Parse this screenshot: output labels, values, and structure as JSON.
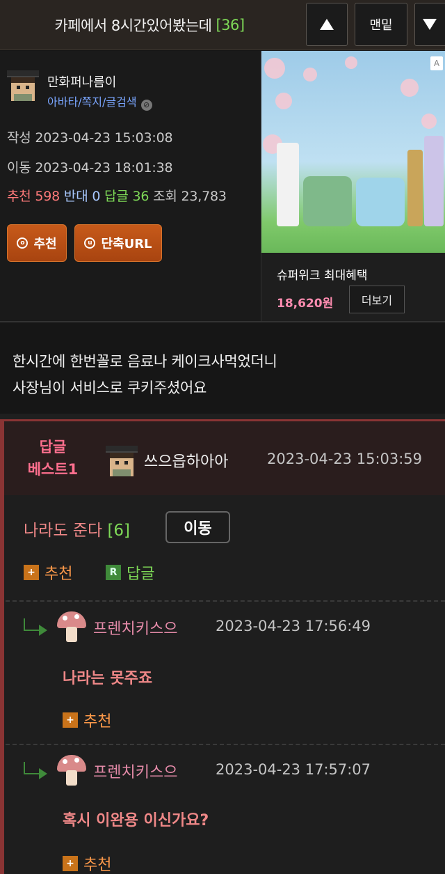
{
  "header": {
    "title": "카페에서 8시간있어봤는데",
    "reply_count": "[36]",
    "bottom_label": "맨밑"
  },
  "post": {
    "author": "만화퍼나름이",
    "author_links": "아바타/쪽지/글검색",
    "written_label": "작성",
    "written": "2023-04-23 15:03:08",
    "moved_label": "이동",
    "moved": "2023-04-23 18:01:38",
    "stats": {
      "rec_label": "추천",
      "rec": "598",
      "anti_label": "반대",
      "anti": "0",
      "reply_label": "답글",
      "reply": "36",
      "views_label": "조회",
      "views": "23,783"
    },
    "buttons": {
      "recommend": "추천",
      "short_url": "단축URL"
    },
    "content": [
      "한시간에 한번꼴로 음료나 케이크사먹었더니",
      "사장님이 서비스로 쿠키주셨어요"
    ]
  },
  "ad": {
    "badge": "A",
    "name": "슈퍼위크 최대혜택",
    "price": "18,620원",
    "more": "더보기"
  },
  "best_reply": {
    "label_line1": "답글",
    "label_line2": "베스트1",
    "author": "쓰으읍하아아",
    "time": "2023-04-23 15:03:59",
    "text": "나라도 준다",
    "count": "[6]",
    "move": "이동",
    "recommend": "추천",
    "reply": "답글"
  },
  "sub_replies": [
    {
      "author": "프렌치키스으",
      "time": "2023-04-23 17:56:49",
      "text": "나라는 못주죠",
      "recommend": "추천"
    },
    {
      "author": "프렌치키스으",
      "time": "2023-04-23 17:57:07",
      "text": "혹시 이완용 이신가요?",
      "recommend": "추천"
    }
  ],
  "colors": {
    "accent_orange": "#c75a1a",
    "reply_green": "#7ed957",
    "best_red": "#8a3434",
    "pink": "#e48aa8"
  }
}
